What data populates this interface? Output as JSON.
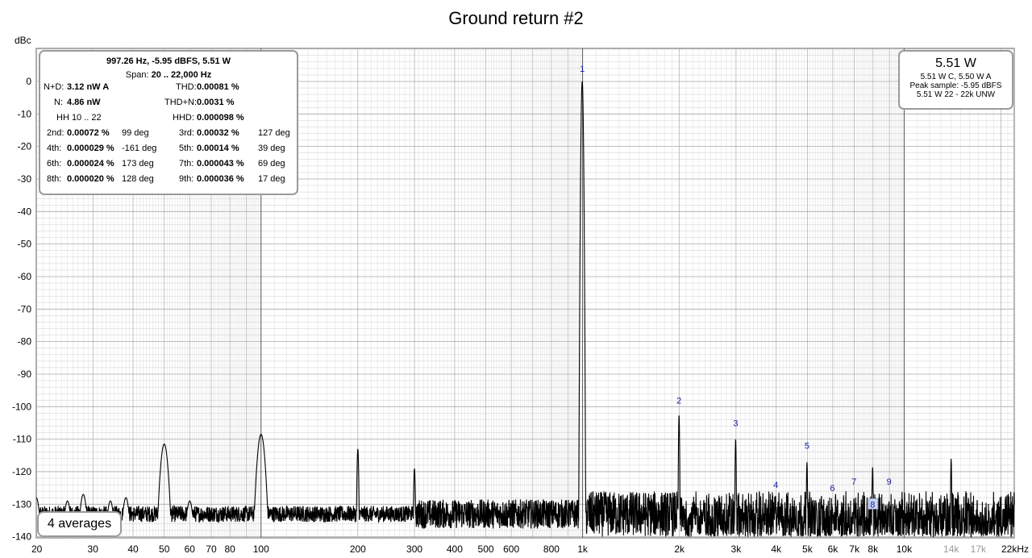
{
  "colors": {
    "grid": "#cfcfcf",
    "grid_major": "#a8a8a8",
    "trace": "#000000",
    "marker": "#1a1aa8",
    "box_border": "#9a9a9a",
    "plot_border": "#b0b0b0"
  },
  "stats": {
    "header": "997.26 Hz, -5.95 dBFS, 5.51 W",
    "span_label": "Span:",
    "span_value": "20 .. 22,000 Hz",
    "nd_label": "N+D:",
    "nd_value": "3.12 nW A",
    "thd_label": "THD:",
    "thd_value": "0.00081 %",
    "n_label": "N:",
    "n_value": "4.86 nW",
    "thdn_label": "THD+N:",
    "thdn_value": "0.0031 %",
    "hh_label": "HH 10 .. 22",
    "hhd_label": "HHD:",
    "hhd_value": "0.000098 %",
    "harmonics": [
      {
        "l1": "2nd:",
        "v1": "0.00072 %",
        "d1": "99 deg",
        "l2": "3rd:",
        "v2": "0.00032 %",
        "d2": "127 deg"
      },
      {
        "l1": "4th:",
        "v1": "0.000029 %",
        "d1": "-161 deg",
        "l2": "5th:",
        "v2": "0.00014 %",
        "d2": "39 deg"
      },
      {
        "l1": "6th:",
        "v1": "0.000024 %",
        "d1": "173 deg",
        "l2": "7th:",
        "v2": "0.000043 %",
        "d2": "69 deg"
      },
      {
        "l1": "8th:",
        "v1": "0.000020 %",
        "d1": "128 deg",
        "l2": "9th:",
        "v2": "0.000036 %",
        "d2": "17 deg"
      }
    ]
  },
  "power": {
    "main": "5.51 W",
    "line1": "5.51 W C, 5.50 W A",
    "line2": "Peak sample: -5.95 dBFS",
    "line3": "5.51 W 22 - 22k UNW"
  },
  "averages_label": "4 averages",
  "chart_data": {
    "type": "line",
    "title": "Ground return #2",
    "ylabel": "dBc",
    "xlabel": "",
    "x_scale": "log",
    "xlim": [
      20,
      22000
    ],
    "ylim": [
      -140,
      10
    ],
    "grid": true,
    "x_ticks": [
      {
        "v": 20,
        "t": "20"
      },
      {
        "v": 30,
        "t": "30"
      },
      {
        "v": 40,
        "t": "40"
      },
      {
        "v": 50,
        "t": "50"
      },
      {
        "v": 60,
        "t": "60"
      },
      {
        "v": 70,
        "t": "70"
      },
      {
        "v": 80,
        "t": "80"
      },
      {
        "v": 100,
        "t": "100"
      },
      {
        "v": 200,
        "t": "200"
      },
      {
        "v": 300,
        "t": "300"
      },
      {
        "v": 400,
        "t": "400"
      },
      {
        "v": 500,
        "t": "500"
      },
      {
        "v": 600,
        "t": "600"
      },
      {
        "v": 800,
        "t": "800"
      },
      {
        "v": 1000,
        "t": "1k"
      },
      {
        "v": 2000,
        "t": "2k"
      },
      {
        "v": 3000,
        "t": "3k"
      },
      {
        "v": 4000,
        "t": "4k"
      },
      {
        "v": 5000,
        "t": "5k"
      },
      {
        "v": 6000,
        "t": "6k"
      },
      {
        "v": 7000,
        "t": "7k"
      },
      {
        "v": 8000,
        "t": "8k"
      },
      {
        "v": 10000,
        "t": "10k"
      },
      {
        "v": 14000,
        "t": "14k",
        "faint": true
      },
      {
        "v": 17000,
        "t": "17k",
        "faint": true
      },
      {
        "v": 22000,
        "t": "22kHz"
      }
    ],
    "y_ticks": [
      0,
      -10,
      -20,
      -30,
      -40,
      -50,
      -60,
      -70,
      -80,
      -90,
      -100,
      -110,
      -120,
      -130,
      -140
    ],
    "noise_floor_dB": -133,
    "peaks": [
      {
        "f": 20,
        "dB": -128
      },
      {
        "f": 25,
        "dB": -129
      },
      {
        "f": 28,
        "dB": -127
      },
      {
        "f": 34,
        "dB": -129
      },
      {
        "f": 38,
        "dB": -128
      },
      {
        "f": 50,
        "dB": -111.5
      },
      {
        "f": 60,
        "dB": -129
      },
      {
        "f": 100,
        "dB": -108.5
      },
      {
        "f": 200,
        "dB": -113
      },
      {
        "f": 300,
        "dB": -119
      },
      {
        "f": 997.26,
        "dB": 0
      },
      {
        "f": 1995,
        "dB": -102.5
      },
      {
        "f": 2992,
        "dB": -110
      },
      {
        "f": 3989,
        "dB": -131
      },
      {
        "f": 4986,
        "dB": -117
      },
      {
        "f": 5984,
        "dB": -131
      },
      {
        "f": 6981,
        "dB": -128
      },
      {
        "f": 7978,
        "dB": -118.5
      },
      {
        "f": 8975,
        "dB": -129
      },
      {
        "f": 14000,
        "dB": -116
      }
    ],
    "harmonic_markers": [
      {
        "n": "1",
        "f": 997.26,
        "dB": 3
      },
      {
        "n": "2",
        "f": 1995,
        "dB": -99
      },
      {
        "n": "3",
        "f": 2992,
        "dB": -106
      },
      {
        "n": "4",
        "f": 3989,
        "dB": -125
      },
      {
        "n": "5",
        "f": 4986,
        "dB": -113
      },
      {
        "n": "6",
        "f": 5984,
        "dB": -126
      },
      {
        "n": "7",
        "f": 6981,
        "dB": -124
      },
      {
        "n": "8",
        "f": 7978,
        "dB": -131,
        "boxed": true
      },
      {
        "n": "9",
        "f": 8975,
        "dB": -124
      }
    ]
  }
}
